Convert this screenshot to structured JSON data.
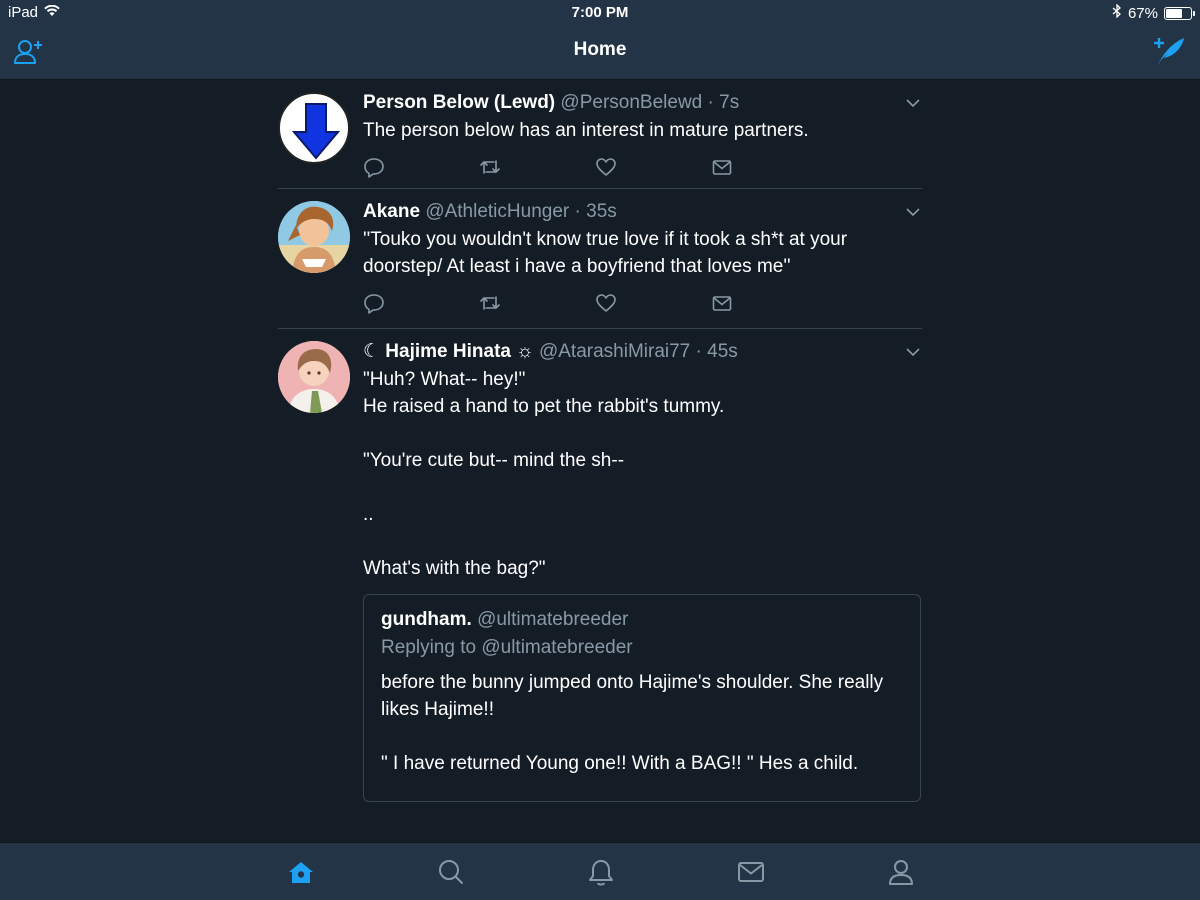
{
  "status_bar": {
    "device": "iPad",
    "time": "7:00 PM",
    "battery": "67%",
    "battery_level": 0.67
  },
  "nav": {
    "title": "Home",
    "left_icon": "add-user-icon",
    "right_icon": "compose-tweet-icon"
  },
  "colors": {
    "accent": "#1da1f2",
    "background": "#141d26",
    "bar": "#243447",
    "secondary_text": "#8899a6",
    "divider": "#38444d"
  },
  "tweets": [
    {
      "name": "Person Below (Lewd)",
      "handle": "@PersonBelewd",
      "time": "7s",
      "text": "The person below has an interest in mature partners."
    },
    {
      "name": "Akane",
      "handle": "@AthleticHunger",
      "time": "35s",
      "text": "''Touko you wouldn't know true love if it took a sh*t at your doorstep/ At least i have a boyfriend that loves me''"
    },
    {
      "name": "☾ Hajime Hinata ☼",
      "handle": "@AtarashiMirai77",
      "time": "45s",
      "text": "\"Huh? What-- hey!\"\nHe raised a hand to pet the rabbit's tummy.\n\n\"You're cute but-- mind the sh--\n\n..\n\nWhat's with the bag?\"",
      "quote": {
        "name": "gundham.",
        "handle": "@ultimatebreeder",
        "reply": "Replying to @ultimatebreeder",
        "text": "before the bunny jumped onto Hajime's shoulder. She really likes Hajime!!\n\n\" I have returned Young one!! With a BAG!! \" Hes a child."
      }
    }
  ],
  "tab_bar": {
    "items": [
      "home-icon",
      "search-icon",
      "notifications-icon",
      "messages-icon",
      "profile-icon"
    ],
    "active": "home-icon"
  }
}
